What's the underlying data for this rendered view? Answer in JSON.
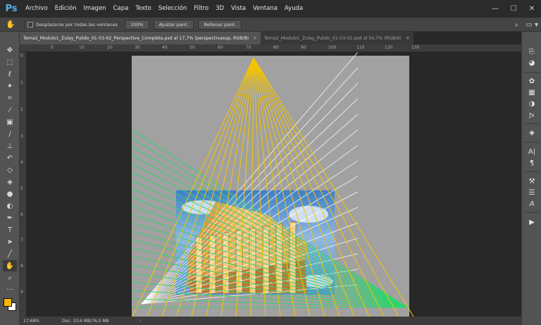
{
  "app": {
    "logo": "Ps"
  },
  "menu": [
    "Archivo",
    "Edición",
    "Imagen",
    "Capa",
    "Texto",
    "Selección",
    "Filtro",
    "3D",
    "Vista",
    "Ventana",
    "Ayuda"
  ],
  "window_controls": {
    "minimize": "—",
    "maximize": "☐",
    "close": "✕"
  },
  "options": {
    "tool_icon": "hand-icon",
    "scroll_all_label": "Desplazarse por todas las ventanas",
    "zoom_100": "100%",
    "fit_screen": "Ajustar pant.",
    "fill_screen": "Rellenar pant.",
    "search_icon": "⌕",
    "workspace_icon": "▭ ▾"
  },
  "tabs": [
    {
      "label": "Tema2_Modulo1_Zulay_Pulido_01-03-02_Perspectiva_Completa.psd al 17,7% (perspectivasup, RGB/8)",
      "close": "×"
    },
    {
      "label": "Tema2_Modulo1_Zulay_Pulido_01-03-02.psd al 54,7% (RGB/8)",
      "close": "×"
    }
  ],
  "ruler": {
    "top": [
      "0",
      "10",
      "20",
      "30",
      "40",
      "50",
      "60",
      "70",
      "80",
      "90",
      "100",
      "110",
      "120",
      "130"
    ],
    "left": [
      "0",
      "1",
      "2",
      "3",
      "4",
      "5",
      "6",
      "7",
      "8",
      "9"
    ]
  },
  "status": {
    "zoom": "17,68%",
    "doc": "Doc: 33,6 MB/76,5 MB",
    "arrow": "›"
  },
  "colors": {
    "foreground": "#f7b900",
    "background": "#ffffff",
    "yellow_lines": "#f5c400",
    "green_lines": "#2bd66e",
    "white_lines": "#ffffff",
    "doc_gray": "#a1a1a1"
  },
  "toolbar_icons": [
    "move-icon",
    "marquee-icon",
    "lasso-icon",
    "magic-wand-icon",
    "crop-icon",
    "eyedropper-icon",
    "healing-brush-icon",
    "brush-icon",
    "clone-stamp-icon",
    "history-brush-icon",
    "eraser-icon",
    "paint-bucket-icon",
    "blur-icon",
    "dodge-icon",
    "pen-icon",
    "type-icon",
    "path-selection-icon",
    "line-icon",
    "hand-icon",
    "zoom-icon",
    "more-icon"
  ],
  "dock_icons": [
    "history-icon",
    "styles-icon",
    "swatches-icon",
    "adjustments-icon",
    "color-icon",
    "fx-icon",
    "layers-icon",
    "character-icon",
    "paragraph-icon",
    "tools-presets-icon",
    "properties-icon",
    "glyphs-icon",
    "play-icon"
  ]
}
